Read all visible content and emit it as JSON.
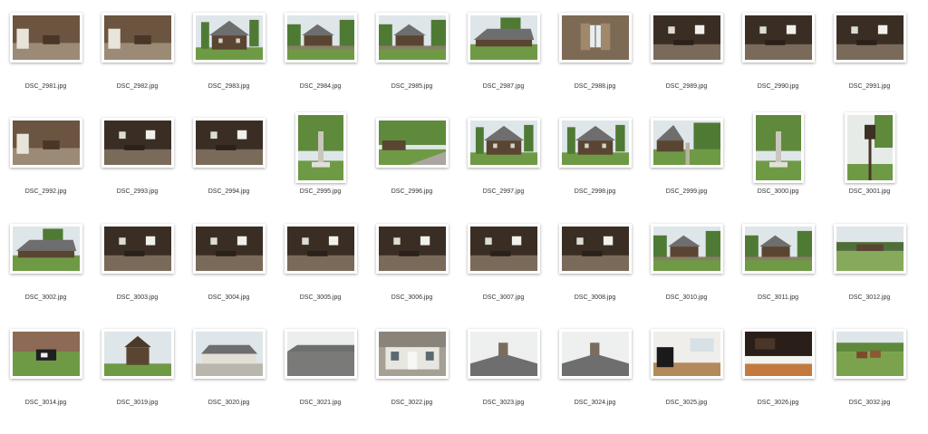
{
  "files": [
    {
      "name": "DSC_2981.jpg",
      "orientation": "landscape",
      "scene": "interior-room"
    },
    {
      "name": "DSC_2982.jpg",
      "orientation": "landscape",
      "scene": "interior-room"
    },
    {
      "name": "DSC_2983.jpg",
      "orientation": "landscape",
      "scene": "house-front"
    },
    {
      "name": "DSC_2984.jpg",
      "orientation": "landscape",
      "scene": "house-fence"
    },
    {
      "name": "DSC_2985.jpg",
      "orientation": "landscape",
      "scene": "house-fence"
    },
    {
      "name": "DSC_2987.jpg",
      "orientation": "landscape",
      "scene": "house-lawn"
    },
    {
      "name": "DSC_2988.jpg",
      "orientation": "landscape",
      "scene": "window"
    },
    {
      "name": "DSC_2989.jpg",
      "orientation": "landscape",
      "scene": "interior-dark"
    },
    {
      "name": "DSC_2990.jpg",
      "orientation": "landscape",
      "scene": "interior-dark"
    },
    {
      "name": "DSC_2991.jpg",
      "orientation": "landscape",
      "scene": "interior-dark"
    },
    {
      "name": "DSC_2992.jpg",
      "orientation": "landscape",
      "scene": "interior-room"
    },
    {
      "name": "DSC_2993.jpg",
      "orientation": "landscape",
      "scene": "interior-dark"
    },
    {
      "name": "DSC_2994.jpg",
      "orientation": "landscape",
      "scene": "interior-dark"
    },
    {
      "name": "DSC_2995.jpg",
      "orientation": "portrait",
      "scene": "monument"
    },
    {
      "name": "DSC_2996.jpg",
      "orientation": "landscape",
      "scene": "road-house"
    },
    {
      "name": "DSC_2997.jpg",
      "orientation": "landscape",
      "scene": "house-front"
    },
    {
      "name": "DSC_2998.jpg",
      "orientation": "landscape",
      "scene": "house-front"
    },
    {
      "name": "DSC_2999.jpg",
      "orientation": "landscape",
      "scene": "house-path"
    },
    {
      "name": "DSC_3000.jpg",
      "orientation": "portrait",
      "scene": "monument"
    },
    {
      "name": "DSC_3001.jpg",
      "orientation": "portrait",
      "scene": "lantern"
    },
    {
      "name": "DSC_3002.jpg",
      "orientation": "landscape",
      "scene": "house-lawn"
    },
    {
      "name": "DSC_3003.jpg",
      "orientation": "landscape",
      "scene": "interior-dark"
    },
    {
      "name": "DSC_3004.jpg",
      "orientation": "landscape",
      "scene": "interior-dark"
    },
    {
      "name": "DSC_3005.jpg",
      "orientation": "landscape",
      "scene": "interior-dark"
    },
    {
      "name": "DSC_3006.jpg",
      "orientation": "landscape",
      "scene": "interior-dark"
    },
    {
      "name": "DSC_3007.jpg",
      "orientation": "landscape",
      "scene": "interior-dark"
    },
    {
      "name": "DSC_3008.jpg",
      "orientation": "landscape",
      "scene": "interior-dark"
    },
    {
      "name": "DSC_3010.jpg",
      "orientation": "landscape",
      "scene": "house-fence"
    },
    {
      "name": "DSC_3011.jpg",
      "orientation": "landscape",
      "scene": "house-fence"
    },
    {
      "name": "DSC_3012.jpg",
      "orientation": "landscape",
      "scene": "field-house"
    },
    {
      "name": "DSC_3014.jpg",
      "orientation": "landscape",
      "scene": "cow"
    },
    {
      "name": "DSC_3019.jpg",
      "orientation": "landscape",
      "scene": "tower"
    },
    {
      "name": "DSC_3020.jpg",
      "orientation": "landscape",
      "scene": "manor"
    },
    {
      "name": "DSC_3021.jpg",
      "orientation": "landscape",
      "scene": "roof"
    },
    {
      "name": "DSC_3022.jpg",
      "orientation": "landscape",
      "scene": "manor-door"
    },
    {
      "name": "DSC_3023.jpg",
      "orientation": "landscape",
      "scene": "chimney"
    },
    {
      "name": "DSC_3024.jpg",
      "orientation": "landscape",
      "scene": "chimney"
    },
    {
      "name": "DSC_3025.jpg",
      "orientation": "landscape",
      "scene": "piano-room"
    },
    {
      "name": "DSC_3026.jpg",
      "orientation": "landscape",
      "scene": "piano"
    },
    {
      "name": "DSC_3032.jpg",
      "orientation": "landscape",
      "scene": "horses"
    }
  ],
  "colors": {
    "background": "#ffffff",
    "label": "#333333",
    "sky": "#dfe6ea",
    "grass": "#6f9a45",
    "wood": "#5a4532",
    "roof": "#6e6e6e",
    "interior": "#3a2e24"
  }
}
